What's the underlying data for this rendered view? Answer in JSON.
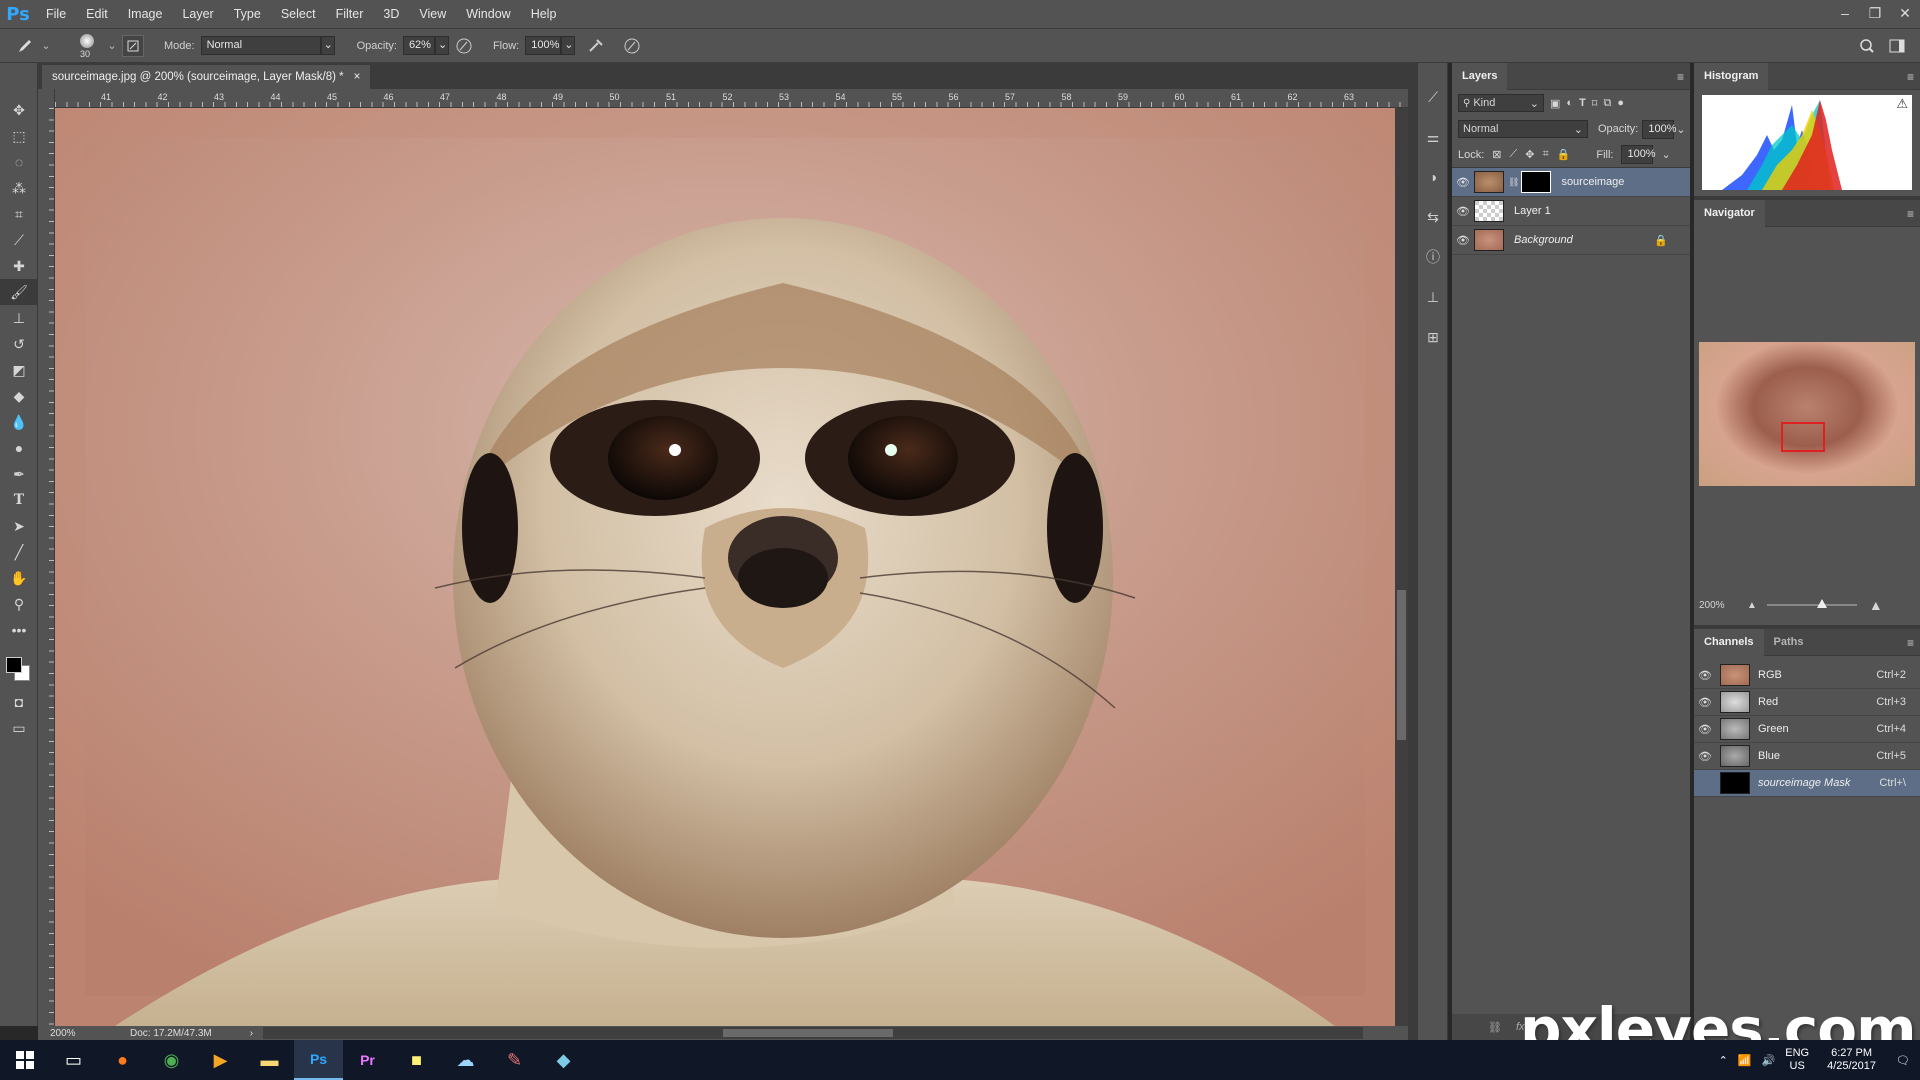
{
  "app": {
    "logo": "Ps"
  },
  "menu": [
    "File",
    "Edit",
    "Image",
    "Layer",
    "Type",
    "Select",
    "Filter",
    "3D",
    "View",
    "Window",
    "Help"
  ],
  "window_controls": [
    "–",
    "❐",
    "✕"
  ],
  "options": {
    "brush_size": "30",
    "mode_label": "Mode:",
    "mode_value": "Normal",
    "opacity_label": "Opacity:",
    "opacity_value": "62%",
    "flow_label": "Flow:",
    "flow_value": "100%"
  },
  "document": {
    "tab_title": "sourceimage.jpg @ 200% (sourceimage, Layer Mask/8) *",
    "close": "×",
    "ruler_ticks": [
      "41",
      "42",
      "43",
      "44",
      "45",
      "46",
      "47",
      "48",
      "49",
      "50",
      "51",
      "52",
      "53",
      "54",
      "55",
      "56",
      "57",
      "58",
      "59",
      "60",
      "61",
      "62",
      "63"
    ],
    "zoom": "200%",
    "doc_info": "Doc: 17.2M/47.3M"
  },
  "layers_panel": {
    "tab": "Layers",
    "filter_label": "Kind",
    "blend_mode": "Normal",
    "opacity_label": "Opacity:",
    "opacity_value": "100%",
    "lock_label": "Lock:",
    "fill_label": "Fill:",
    "fill_value": "100%",
    "layers": [
      {
        "name": "sourceimage",
        "selected": true
      },
      {
        "name": "Layer 1",
        "selected": false
      },
      {
        "name": "Background",
        "selected": false
      }
    ]
  },
  "histogram_panel": {
    "tab": "Histogram",
    "warning": "⚠"
  },
  "navigator_panel": {
    "tab": "Navigator",
    "zoom": "200%"
  },
  "channels_panel": {
    "tabs": [
      "Channels",
      "Paths"
    ],
    "channels": [
      {
        "name": "RGB",
        "key": "Ctrl+2"
      },
      {
        "name": "Red",
        "key": "Ctrl+3"
      },
      {
        "name": "Green",
        "key": "Ctrl+4"
      },
      {
        "name": "Blue",
        "key": "Ctrl+5"
      },
      {
        "name": "sourceimage Mask",
        "key": "Ctrl+\\"
      }
    ]
  },
  "taskbar": {
    "lang": "ENG",
    "region": "US",
    "time": "6:27 PM",
    "date": "4/25/2017"
  },
  "watermark": "pxleyes.com",
  "colors": {
    "accent": "#31a8ff",
    "selection": "#5e6e86",
    "panel": "#535353"
  }
}
